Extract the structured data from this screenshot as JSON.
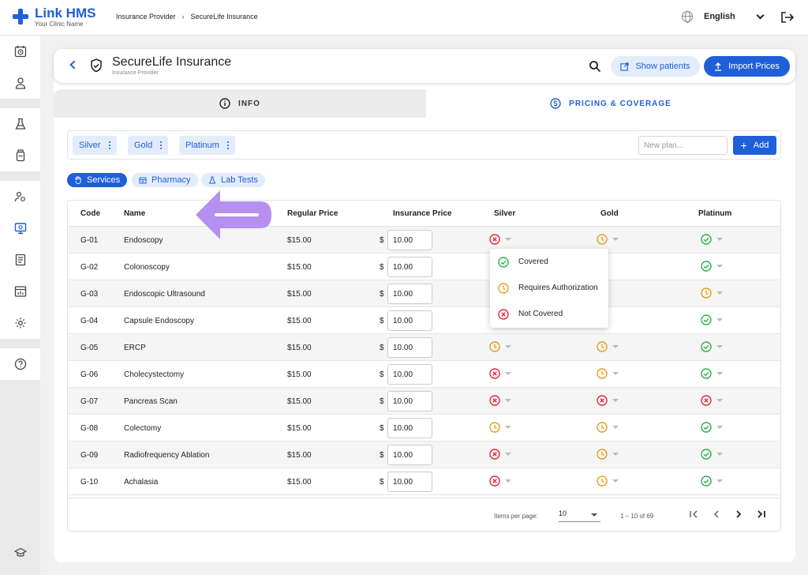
{
  "app": {
    "name": "Link HMS",
    "tagline": "Your Clinic Name"
  },
  "breadcrumb": {
    "parent": "Insurance Provider",
    "current": "SecureLife Insurance"
  },
  "language": "English",
  "header": {
    "title": "SecureLife Insurance",
    "subtitle": "Insurance Provider",
    "show_patients": "Show patients",
    "import_prices": "Import Prices"
  },
  "tabs": {
    "info": "INFO",
    "pricing": "PRICING & COVERAGE"
  },
  "plans": {
    "items": [
      "Silver",
      "Gold",
      "Platinum"
    ],
    "new_placeholder": "New plan...",
    "add_label": "Add"
  },
  "categories": {
    "services": "Services",
    "pharmacy": "Pharmacy",
    "lab_tests": "Lab Tests"
  },
  "table": {
    "headers": {
      "code": "Code",
      "name": "Name",
      "regular_price": "Regular Price",
      "insurance_price": "Insurance Price",
      "silver": "Silver",
      "gold": "Gold",
      "platinum": "Platinum"
    },
    "currency": "$",
    "rows": [
      {
        "code": "G-01",
        "name": "Endoscopy",
        "regular": "$15.00",
        "insurance": "10.00",
        "silver": "not",
        "gold": "auth",
        "platinum": "covered"
      },
      {
        "code": "G-02",
        "name": "Colonoscopy",
        "regular": "$15.00",
        "insurance": "10.00",
        "silver": "",
        "gold": "",
        "platinum": "covered"
      },
      {
        "code": "G-03",
        "name": "Endoscopic Ultrasound",
        "regular": "$15.00",
        "insurance": "10.00",
        "silver": "",
        "gold": "",
        "platinum": "auth"
      },
      {
        "code": "G-04",
        "name": "Capsule Endoscopy",
        "regular": "$15.00",
        "insurance": "10.00",
        "silver": "",
        "gold": "",
        "platinum": "covered"
      },
      {
        "code": "G-05",
        "name": "ERCP",
        "regular": "$15.00",
        "insurance": "10.00",
        "silver": "auth",
        "gold": "auth",
        "platinum": "covered"
      },
      {
        "code": "G-06",
        "name": "Cholecystectomy",
        "regular": "$15.00",
        "insurance": "10.00",
        "silver": "not",
        "gold": "auth",
        "platinum": "covered"
      },
      {
        "code": "G-07",
        "name": "Pancreas Scan",
        "regular": "$15.00",
        "insurance": "10.00",
        "silver": "not",
        "gold": "not",
        "platinum": "not"
      },
      {
        "code": "G-08",
        "name": "Colectomy",
        "regular": "$15.00",
        "insurance": "10.00",
        "silver": "auth",
        "gold": "auth",
        "platinum": "covered"
      },
      {
        "code": "G-09",
        "name": "Radiofrequency Ablation",
        "regular": "$15.00",
        "insurance": "10.00",
        "silver": "not",
        "gold": "auth",
        "platinum": "covered"
      },
      {
        "code": "G-10",
        "name": "Achalasia",
        "regular": "$15.00",
        "insurance": "10.00",
        "silver": "not",
        "gold": "auth",
        "platinum": "covered"
      }
    ]
  },
  "dropdown": {
    "covered": "Covered",
    "auth": "Requires Authorization",
    "not": "Not Covered"
  },
  "paginator": {
    "items_per_page_label": "Items per page:",
    "page_size": "10",
    "range": "1 – 10 of 69"
  },
  "colors": {
    "primary": "#1f5fd8",
    "covered": "#2bb24c",
    "auth": "#e3a019",
    "not_covered": "#e0283a",
    "annotation": "#b590f0"
  }
}
